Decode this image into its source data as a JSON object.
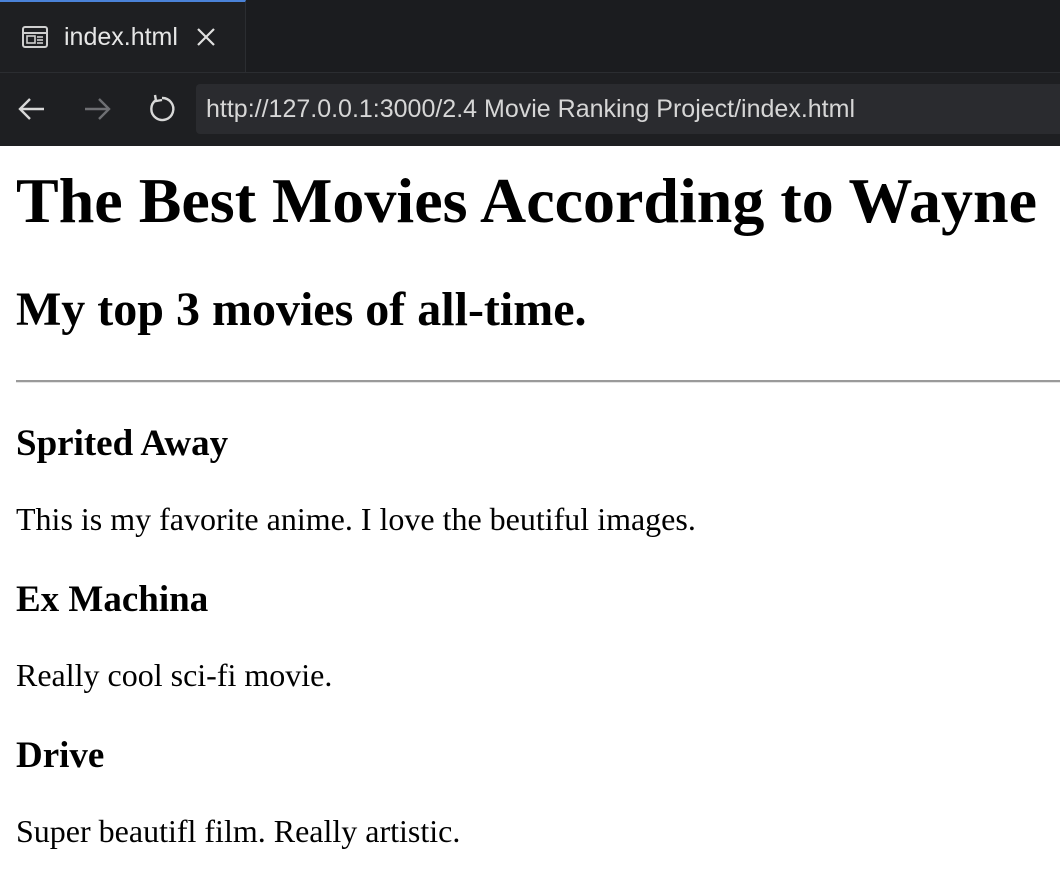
{
  "browser": {
    "tab": {
      "title": "index.html",
      "icon": "preview-icon"
    },
    "address_bar": {
      "url": "http://127.0.0.1:3000/2.4 Movie Ranking Project/index.html"
    }
  },
  "page": {
    "heading": "The Best Movies According to Wayne",
    "subheading": "My top 3 movies of all-time.",
    "movies": [
      {
        "title": "Sprited Away",
        "description": "This is my favorite anime. I love the beutiful images."
      },
      {
        "title": "Ex Machina",
        "description": "Really cool sci-fi movie."
      },
      {
        "title": "Drive",
        "description": "Super beautifl film. Really artistic."
      }
    ]
  },
  "colors": {
    "chrome_background": "#1e1f22",
    "tab_accent": "#4a82d8",
    "url_background": "#2a2b2f"
  }
}
